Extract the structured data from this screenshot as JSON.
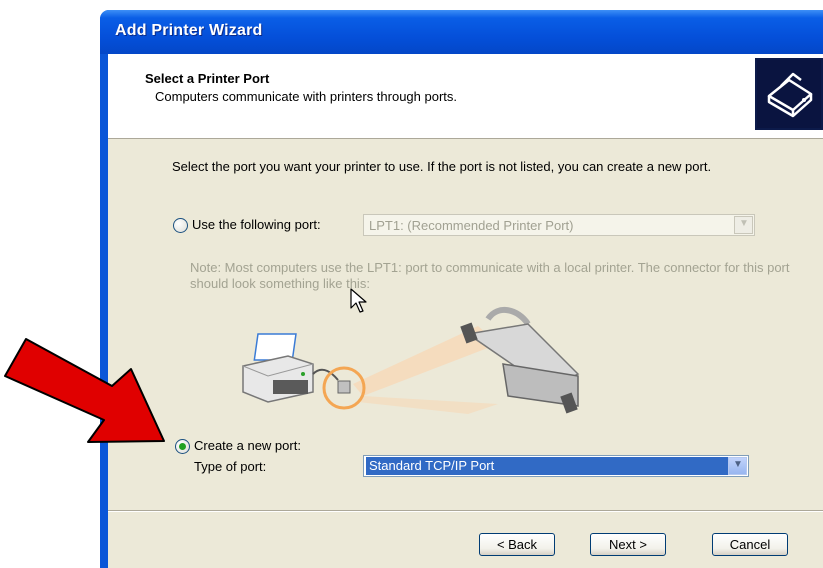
{
  "window": {
    "title": "Add Printer Wizard"
  },
  "header": {
    "title": "Select a Printer Port",
    "subtitle": "Computers communicate with printers through ports."
  },
  "body": {
    "description": "Select the port you want your printer to use.  If the port is not listed, you can create a new port.",
    "use_port": {
      "label": "Use the following port:",
      "selected_value": "LPT1: (Recommended Printer Port)",
      "checked": false
    },
    "note": "Note: Most computers use the LPT1: port to communicate with a local printer. The connector for this port should look something like this:",
    "create_port": {
      "label": "Create a new port:",
      "type_label": "Type of port:",
      "selected_value": "Standard TCP/IP Port",
      "checked": true
    }
  },
  "footer": {
    "back_label": "< Back",
    "next_label": "Next >",
    "cancel_label": "Cancel"
  },
  "icons": [
    "printer-wizard-icon",
    "printer-illustration",
    "parallel-cable-illustration",
    "mouse-cursor-icon",
    "red-arrow-annotation"
  ],
  "colors": {
    "title_bar": "#0550da",
    "selection": "#316ac5",
    "annotation_arrow": "#e00000"
  }
}
